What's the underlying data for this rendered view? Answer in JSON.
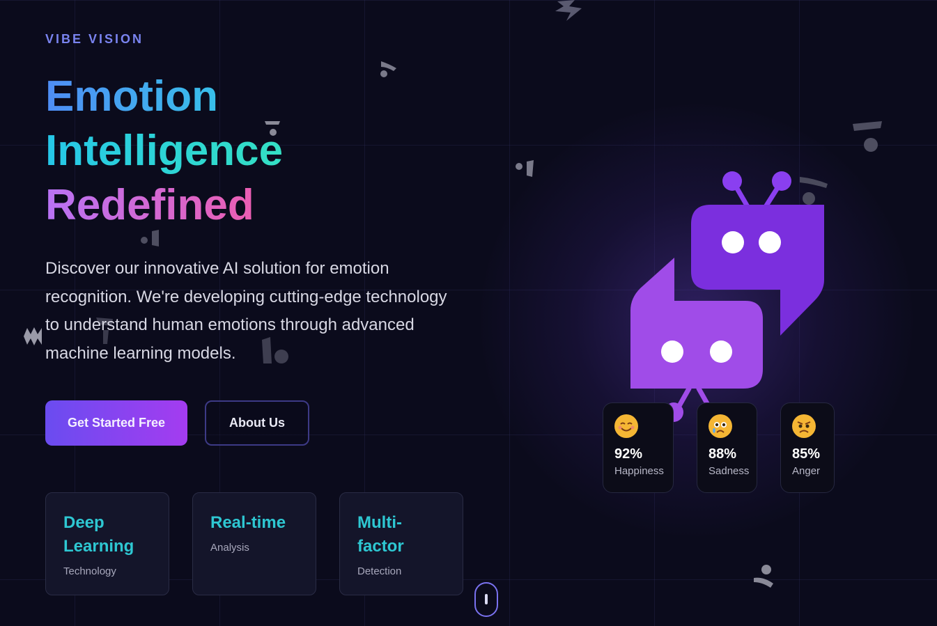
{
  "brand": "VIBE VISION",
  "hero": {
    "title_line1": "Emotion",
    "title_line2": "Intelligence",
    "title_line3": "Redefined",
    "description": "Discover our innovative AI solution for emotion recognition. We're developing cutting-edge technology to understand human emotions through advanced machine learning models."
  },
  "buttons": {
    "primary": "Get Started Free",
    "secondary": "About Us"
  },
  "features": [
    {
      "title": "Deep Learning",
      "subtitle": "Technology"
    },
    {
      "title": "Real-time",
      "subtitle": "Analysis"
    },
    {
      "title": "Multi-factor",
      "subtitle": "Detection"
    }
  ],
  "emotions": [
    {
      "value": "92%",
      "label": "Happiness",
      "icon": "smiling-face-icon"
    },
    {
      "value": "88%",
      "label": "Sadness",
      "icon": "crying-face-icon"
    },
    {
      "value": "85%",
      "label": "Anger",
      "icon": "angry-face-icon"
    }
  ],
  "colors": {
    "background": "#0b0b1c",
    "accent_purple": "#7b3fe4",
    "accent_teal": "#2ec7d2",
    "accent_blue": "#4f8df5",
    "accent_pink": "#f35ba9"
  }
}
